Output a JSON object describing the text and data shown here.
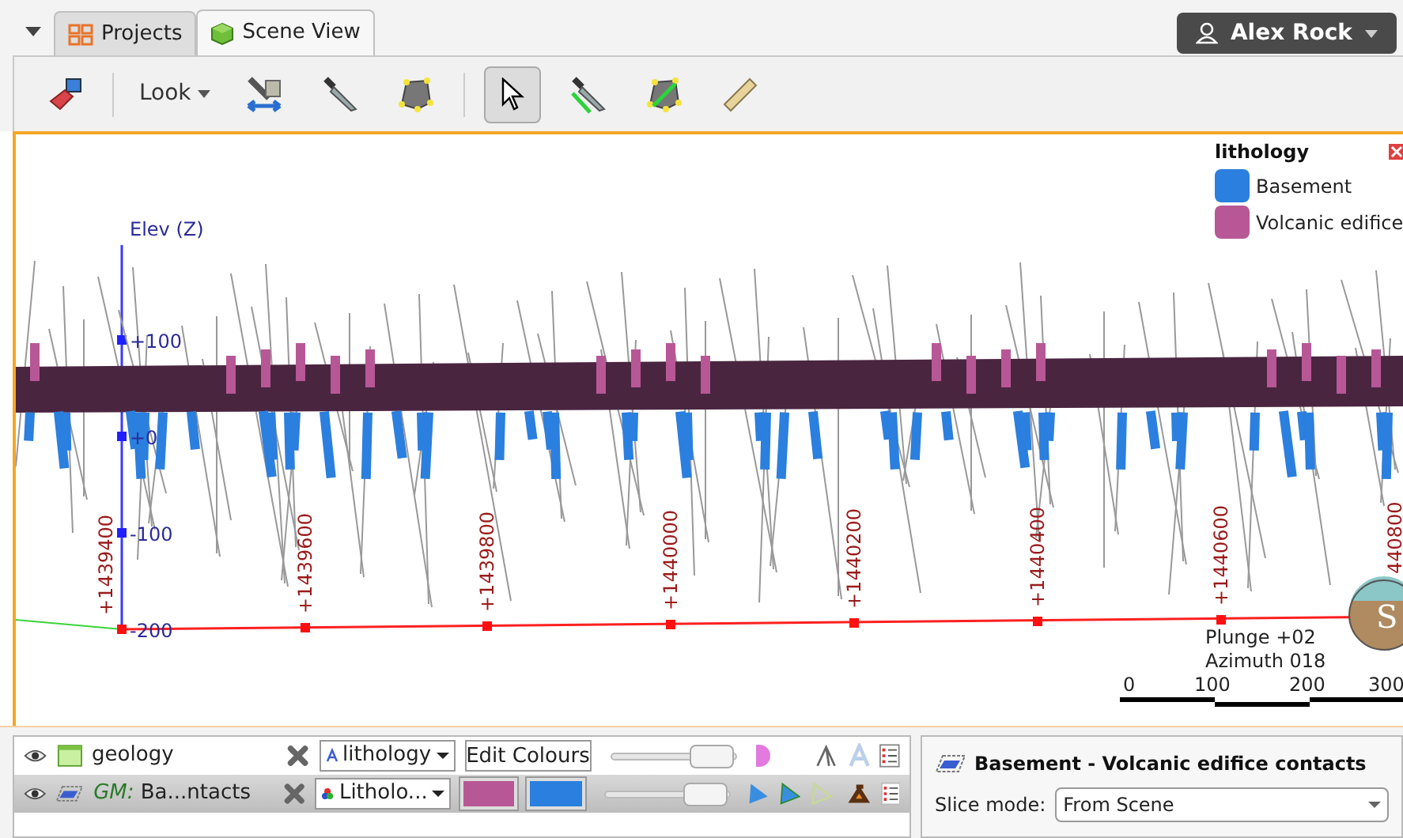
{
  "tabs": [
    {
      "label": "Projects",
      "kind": "grid",
      "selected": false
    },
    {
      "label": "Scene View",
      "kind": "cube",
      "selected": true
    }
  ],
  "user": {
    "name": "Alex Rock"
  },
  "toolbar": {
    "look_menu": "Look",
    "tools": [
      {
        "kind": "eraser",
        "selected": false
      },
      {
        "kind": "look",
        "selected": false
      },
      {
        "kind": "view-align",
        "selected": false
      },
      {
        "kind": "knife",
        "selected": false
      },
      {
        "kind": "polygon",
        "selected": false
      },
      {
        "kind": "pointer",
        "selected": true
      },
      {
        "kind": "knife-line",
        "selected": false
      },
      {
        "kind": "polygon-line",
        "selected": false
      },
      {
        "kind": "ruler",
        "selected": false
      }
    ]
  },
  "scene": {
    "axis_title": "Elev (Z)",
    "elevation_ticks": [
      "+100",
      "+0",
      "-100",
      "-200"
    ],
    "easting_labels": [
      "+1439400",
      "+1439600",
      "+1439800",
      "+1440000",
      "+1440200",
      "+1440400",
      "+1440600",
      "440800"
    ],
    "orientation": [
      "Plunge +02",
      "Azimuth 018"
    ],
    "scale_labels": [
      "0",
      "100",
      "200",
      "300"
    ],
    "compass_label": "S",
    "legend": {
      "title": "lithology",
      "items": [
        {
          "label": "Basement",
          "color": "#2b7fde"
        },
        {
          "label": "Volcanic edifice",
          "color": "#b85796"
        }
      ]
    }
  },
  "layers": [
    {
      "kind": "table",
      "name": "geology",
      "menu": "lithology",
      "action": "Edit Colours",
      "selected": false
    },
    {
      "kind": "mesh",
      "prefix": "GM:",
      "name": " Ba...ntacts",
      "menu": "Litholo...",
      "swatches": [
        {
          "color": "#b85796"
        },
        {
          "color": "#2b7fde"
        }
      ],
      "selected": true
    }
  ],
  "properties": {
    "title": "Basement - Volcanic edifice contacts",
    "slice_mode_label": "Slice mode:",
    "slice_mode_value": "From Scene"
  }
}
